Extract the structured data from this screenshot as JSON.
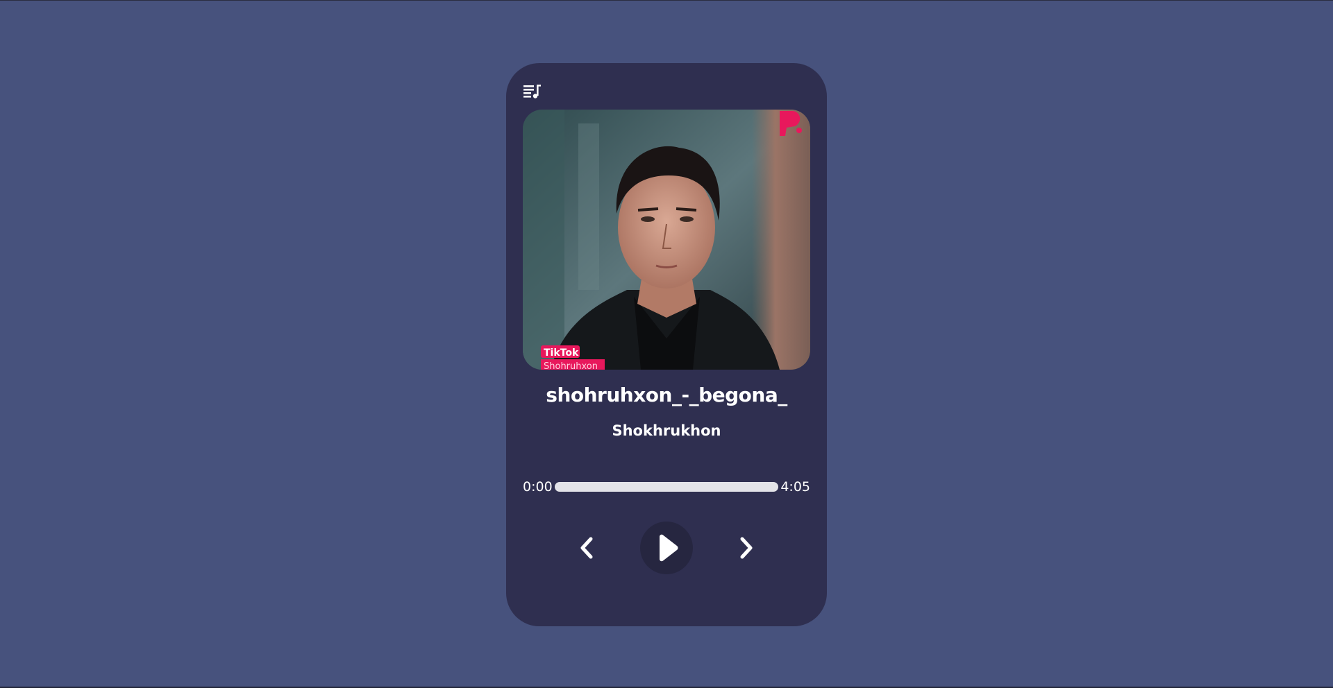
{
  "track": {
    "title": "shohruhxon_-_begona_",
    "artist": "Shokhrukhon"
  },
  "cover": {
    "badge_primary": "TikTok",
    "badge_secondary": "Shohruhxon"
  },
  "progress": {
    "current_time": "0:00",
    "total_time": "4:05",
    "fraction": 0
  },
  "icons": {
    "playlist": "playlist-music-icon",
    "prev": "chevron-left-icon",
    "play": "play-icon",
    "next": "chevron-right-icon",
    "brand": "brand-logo-icon"
  },
  "colors": {
    "background": "#47527d",
    "card": "#2f2f50",
    "play_button": "#262640",
    "accent": "#e8185c",
    "text": "#ffffff"
  }
}
